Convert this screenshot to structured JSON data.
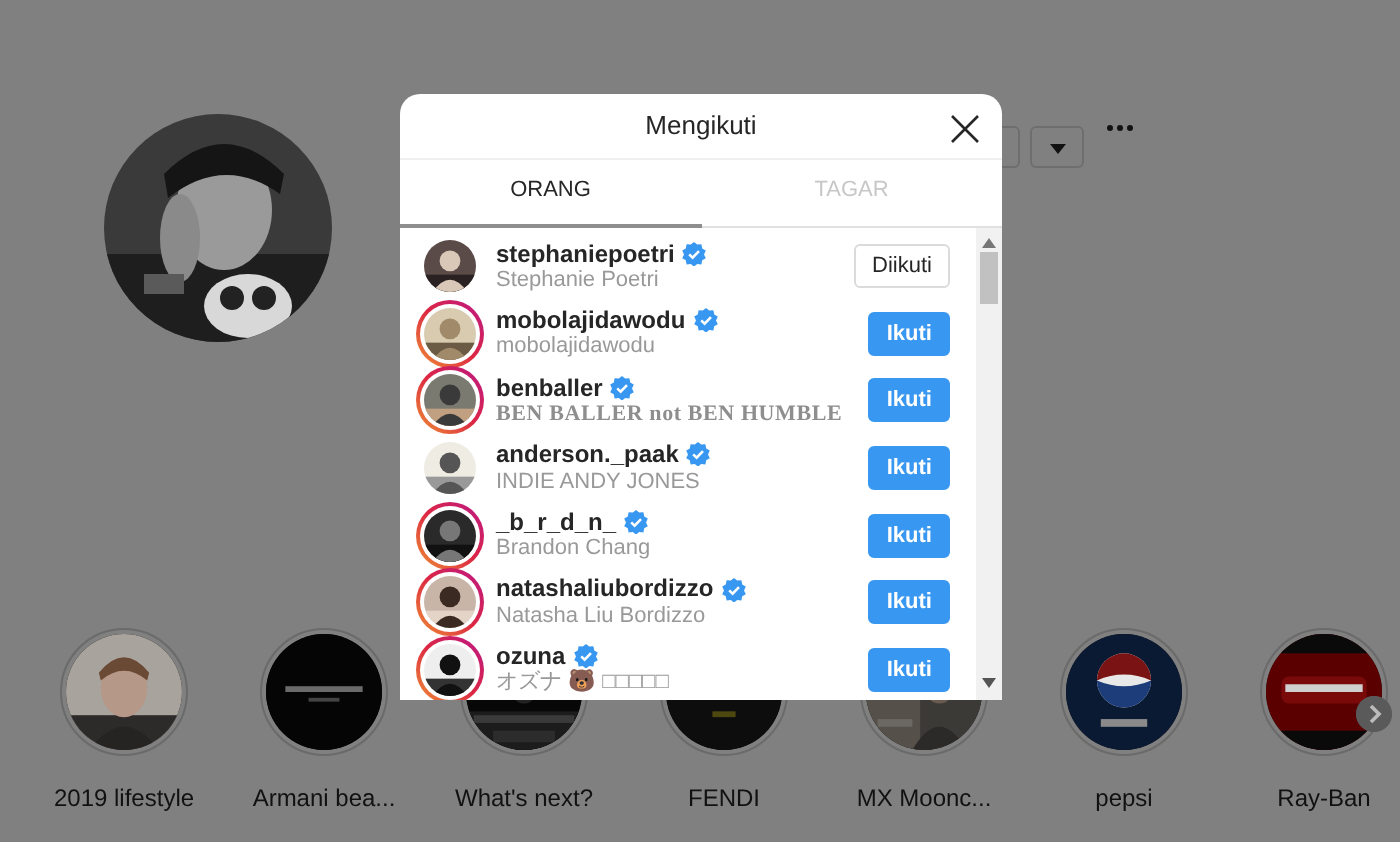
{
  "modal": {
    "title": "Mengikuti",
    "tabs": [
      {
        "label": "ORANG",
        "selected": true
      },
      {
        "label": "TAGAR",
        "selected": false
      }
    ],
    "users": [
      {
        "username": "stephaniepoetri",
        "subtitle": "Stephanie Poetri",
        "kind": "plain",
        "verified": true,
        "ring": false,
        "following": true,
        "button": "Diikuti"
      },
      {
        "username": "mobolajidawodu",
        "subtitle": "mobolajidawodu",
        "kind": "plain",
        "verified": true,
        "ring": true,
        "following": false,
        "button": "Ikuti"
      },
      {
        "username": "benballer",
        "subtitle": "BEN BALLER not BEN HUMBLE",
        "kind": "fancy",
        "verified": true,
        "ring": true,
        "following": false,
        "button": "Ikuti"
      },
      {
        "username": "anderson._paak",
        "subtitle": "INDIE ANDY JONES",
        "kind": "plain",
        "verified": true,
        "ring": false,
        "following": false,
        "button": "Ikuti"
      },
      {
        "username": "_b_r_d_n_",
        "subtitle": "Brandon Chang",
        "kind": "plain",
        "verified": true,
        "ring": true,
        "following": false,
        "button": "Ikuti"
      },
      {
        "username": "natashaliubordizzo",
        "subtitle": "Natasha Liu Bordizzo",
        "kind": "plain",
        "verified": true,
        "ring": true,
        "following": false,
        "button": "Ikuti"
      },
      {
        "username": "ozuna",
        "subtitle": "オズナ 🐻 □□□□□",
        "kind": "plain",
        "verified": true,
        "ring": true,
        "following": false,
        "button": "Ikuti"
      }
    ]
  },
  "highlights": [
    {
      "label": "2019 lifestyle"
    },
    {
      "label": "Armani bea..."
    },
    {
      "label": "What's next?"
    },
    {
      "label": "FENDI"
    },
    {
      "label": "MX Moonc..."
    },
    {
      "label": "pepsi"
    },
    {
      "label": "Ray-Ban"
    }
  ]
}
